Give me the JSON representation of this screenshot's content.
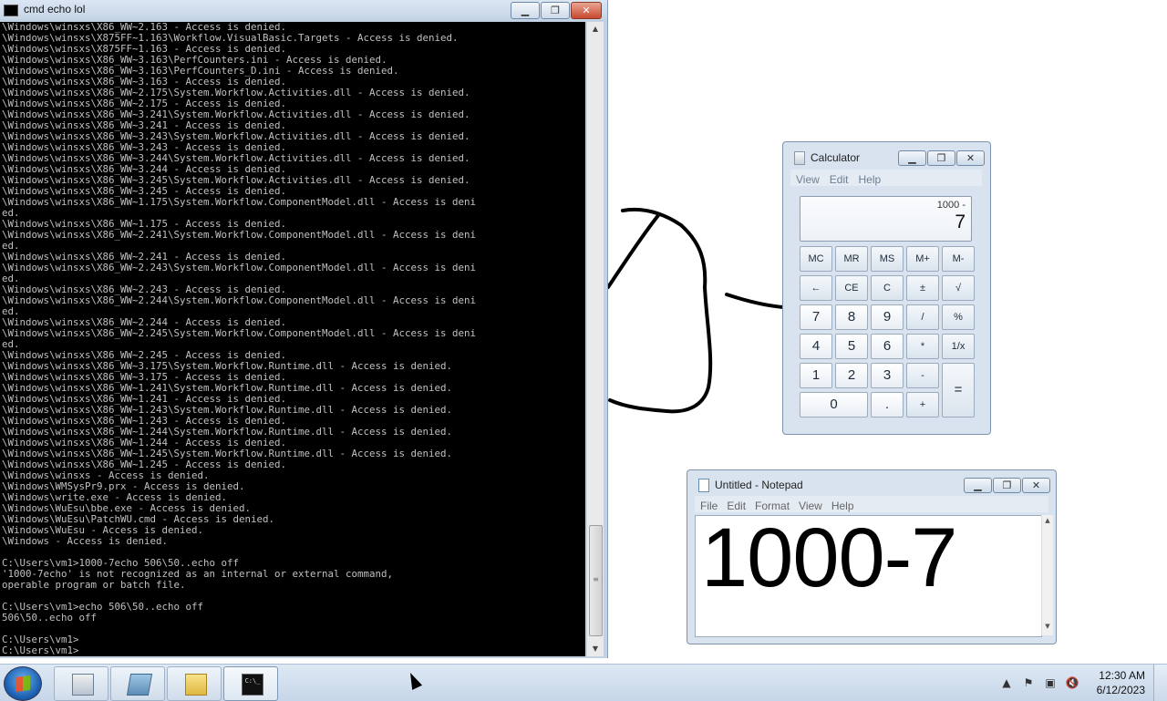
{
  "cmd": {
    "title": "cmd  echo lol",
    "lines": [
      "\\Windows\\winsxs\\X86_WW~2.163 - Access is denied.",
      "\\Windows\\winsxs\\X875FF~1.163\\Workflow.VisualBasic.Targets - Access is denied.",
      "\\Windows\\winsxs\\X875FF~1.163 - Access is denied.",
      "\\Windows\\winsxs\\X86_WW~3.163\\PerfCounters.ini - Access is denied.",
      "\\Windows\\winsxs\\X86_WW~3.163\\PerfCounters_D.ini - Access is denied.",
      "\\Windows\\winsxs\\X86_WW~3.163 - Access is denied.",
      "\\Windows\\winsxs\\X86_WW~2.175\\System.Workflow.Activities.dll - Access is denied.",
      "\\Windows\\winsxs\\X86_WW~2.175 - Access is denied.",
      "\\Windows\\winsxs\\X86_WW~3.241\\System.Workflow.Activities.dll - Access is denied.",
      "\\Windows\\winsxs\\X86_WW~3.241 - Access is denied.",
      "\\Windows\\winsxs\\X86_WW~3.243\\System.Workflow.Activities.dll - Access is denied.",
      "\\Windows\\winsxs\\X86_WW~3.243 - Access is denied.",
      "\\Windows\\winsxs\\X86_WW~3.244\\System.Workflow.Activities.dll - Access is denied.",
      "\\Windows\\winsxs\\X86_WW~3.244 - Access is denied.",
      "\\Windows\\winsxs\\X86_WW~3.245\\System.Workflow.Activities.dll - Access is denied.",
      "\\Windows\\winsxs\\X86_WW~3.245 - Access is denied.",
      "\\Windows\\winsxs\\X86_WW~1.175\\System.Workflow.ComponentModel.dll - Access is deni",
      "ed.",
      "\\Windows\\winsxs\\X86_WW~1.175 - Access is denied.",
      "\\Windows\\winsxs\\X86_WW~2.241\\System.Workflow.ComponentModel.dll - Access is deni",
      "ed.",
      "\\Windows\\winsxs\\X86_WW~2.241 - Access is denied.",
      "\\Windows\\winsxs\\X86_WW~2.243\\System.Workflow.ComponentModel.dll - Access is deni",
      "ed.",
      "\\Windows\\winsxs\\X86_WW~2.243 - Access is denied.",
      "\\Windows\\winsxs\\X86_WW~2.244\\System.Workflow.ComponentModel.dll - Access is deni",
      "ed.",
      "\\Windows\\winsxs\\X86_WW~2.244 - Access is denied.",
      "\\Windows\\winsxs\\X86_WW~2.245\\System.Workflow.ComponentModel.dll - Access is deni",
      "ed.",
      "\\Windows\\winsxs\\X86_WW~2.245 - Access is denied.",
      "\\Windows\\winsxs\\X86_WW~3.175\\System.Workflow.Runtime.dll - Access is denied.",
      "\\Windows\\winsxs\\X86_WW~3.175 - Access is denied.",
      "\\Windows\\winsxs\\X86_WW~1.241\\System.Workflow.Runtime.dll - Access is denied.",
      "\\Windows\\winsxs\\X86_WW~1.241 - Access is denied.",
      "\\Windows\\winsxs\\X86_WW~1.243\\System.Workflow.Runtime.dll - Access is denied.",
      "\\Windows\\winsxs\\X86_WW~1.243 - Access is denied.",
      "\\Windows\\winsxs\\X86_WW~1.244\\System.Workflow.Runtime.dll - Access is denied.",
      "\\Windows\\winsxs\\X86_WW~1.244 - Access is denied.",
      "\\Windows\\winsxs\\X86_WW~1.245\\System.Workflow.Runtime.dll - Access is denied.",
      "\\Windows\\winsxs\\X86_WW~1.245 - Access is denied.",
      "\\Windows\\winsxs - Access is denied.",
      "\\Windows\\WMSysPr9.prx - Access is denied.",
      "\\Windows\\write.exe - Access is denied.",
      "\\Windows\\WuEsu\\bbe.exe - Access is denied.",
      "\\Windows\\WuEsu\\PatchWU.cmd - Access is denied.",
      "\\Windows\\WuEsu - Access is denied.",
      "\\Windows - Access is denied.",
      "",
      "C:\\Users\\vm1>1000-7echo 506\\50..echo off",
      "'1000-7echo' is not recognized as an internal or external command,",
      "operable program or batch file.",
      "",
      "C:\\Users\\vm1>echo 506\\50..echo off",
      "506\\50..echo off",
      "",
      "C:\\Users\\vm1>",
      "C:\\Users\\vm1>"
    ]
  },
  "calculator": {
    "title": "Calculator",
    "menu": [
      "View",
      "Edit",
      "Help"
    ],
    "expression": "1000 -",
    "value": "7",
    "keys": [
      [
        "MC",
        "MR",
        "MS",
        "M+",
        "M-"
      ],
      [
        "←",
        "CE",
        "C",
        "±",
        "√"
      ],
      [
        "7",
        "8",
        "9",
        "/",
        "%"
      ],
      [
        "4",
        "5",
        "6",
        "*",
        "1/x"
      ],
      [
        "1",
        "2",
        "3",
        "-",
        "="
      ],
      [
        "0",
        ".",
        "+"
      ]
    ]
  },
  "notepad": {
    "title": "Untitled - Notepad",
    "menu": [
      "File",
      "Edit",
      "Format",
      "View",
      "Help"
    ],
    "content": "1000-7"
  },
  "taskbar": {
    "items": [
      "calculator-icon",
      "explorer-icon",
      "folder-icon",
      "cmd-icon"
    ],
    "cmd_icon_text": "C:\\_",
    "clock_time": "12:30 AM",
    "clock_date": "6/12/2023"
  }
}
